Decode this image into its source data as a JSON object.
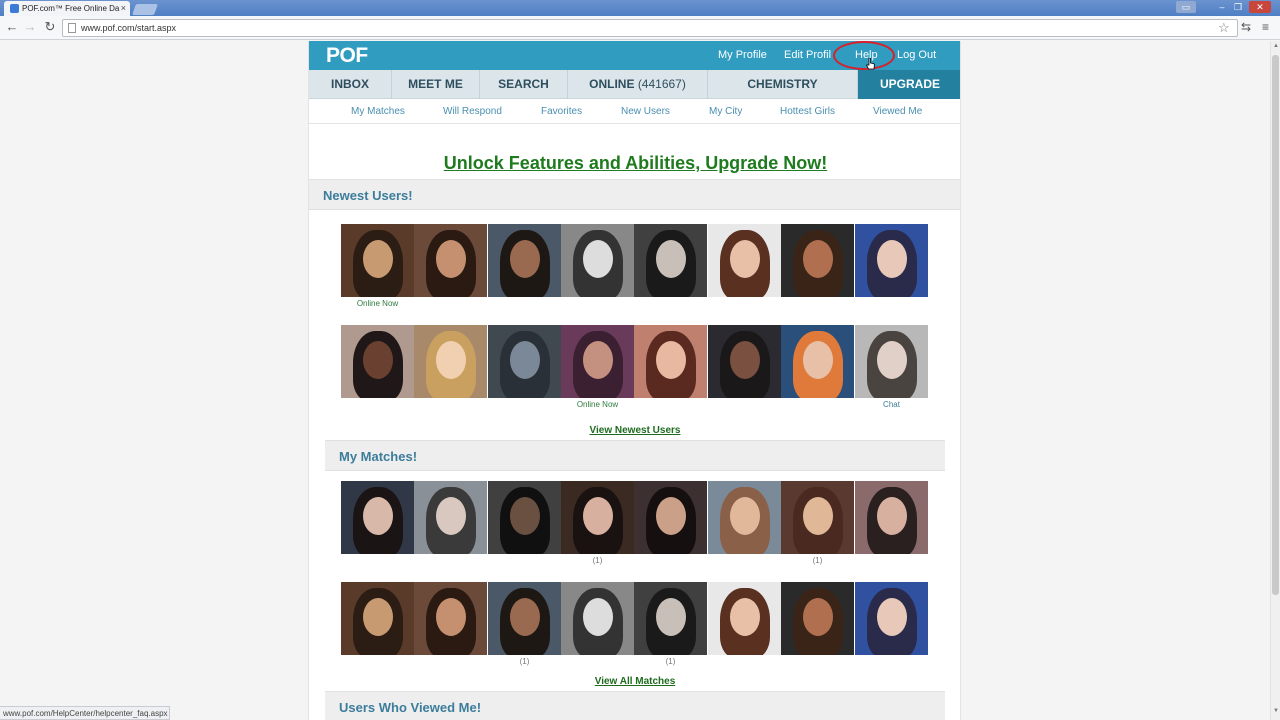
{
  "browser": {
    "tab_title": "POF.com™ Free Online Da",
    "tab_close": "×",
    "url": "www.pof.com/start.aspx",
    "status_url": "www.pof.com/HelpCenter/helpcenter_faq.aspx",
    "icons": [
      "back-icon",
      "forward-icon",
      "reload-icon",
      "star-icon",
      "extension-icon",
      "menu-icon"
    ]
  },
  "header": {
    "logo": "POF",
    "links": {
      "my_profile": "My Profile",
      "edit_profile": "Edit Profil",
      "help": "Help",
      "log_out": "Log Out"
    },
    "accent": "#2f9cc0",
    "highlight_color": "#d8202c"
  },
  "nav": {
    "inbox": "INBOX",
    "meet_me": "MEET ME",
    "search": "SEARCH",
    "online": "ONLINE",
    "online_count": "(441667)",
    "chemistry": "CHEMISTRY",
    "upgrade": "UPGRADE"
  },
  "subnav": {
    "my_matches": "My Matches",
    "will_respond": "Will Respond",
    "favorites": "Favorites",
    "new_users": "New Users",
    "my_city": "My City",
    "hottest_girls": "Hottest Girls",
    "viewed_me": "Viewed Me"
  },
  "banner": "Unlock Features and Abilities, Upgrade Now!",
  "newest_users": {
    "title": "Newest Users!",
    "row1_captions": [
      "Online Now",
      "",
      "",
      "",
      "",
      "",
      "",
      ""
    ],
    "row2_captions": [
      "",
      "",
      "",
      "Online Now",
      "",
      "",
      "",
      "Chat"
    ],
    "view_link": "View Newest Users"
  },
  "my_matches": {
    "title": "My Matches!",
    "row1_captions": [
      "",
      "",
      "",
      "(1)",
      "",
      "",
      "(1)",
      ""
    ],
    "row2_captions": [
      "",
      "",
      "(1)",
      "",
      "(1)",
      "",
      "",
      ""
    ],
    "view_link": "View All Matches"
  },
  "viewed_me": {
    "title": "Users Who Viewed Me!"
  }
}
